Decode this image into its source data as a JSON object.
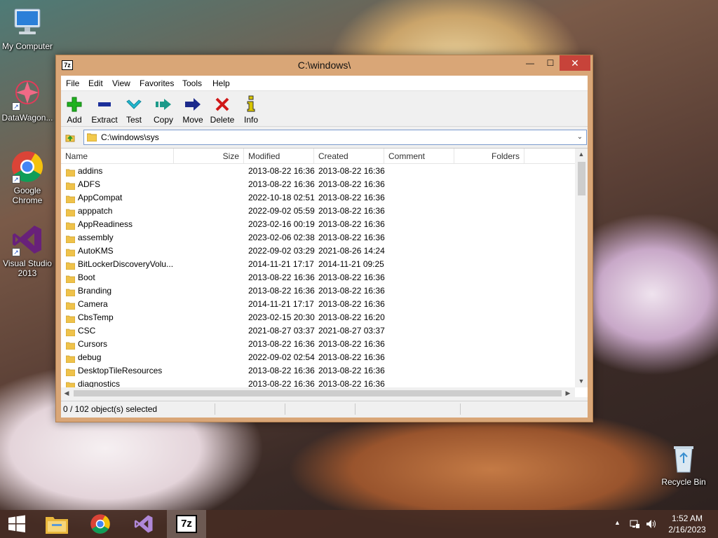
{
  "desktop": {
    "icons": [
      {
        "label": "My Computer"
      },
      {
        "label": "DataWagon..."
      },
      {
        "label": "Google Chrome"
      },
      {
        "label": "Visual Studio 2013"
      },
      {
        "label": "Recycle Bin"
      }
    ]
  },
  "window": {
    "app_icon_text": "7z",
    "title": "C:\\windows\\",
    "controls": {
      "minimize": "—",
      "maximize": "☐",
      "close": "✕"
    },
    "menu": [
      "File",
      "Edit",
      "View",
      "Favorites",
      "Tools",
      "Help"
    ],
    "toolbar": [
      {
        "label": "Add",
        "icon": "plus-icon",
        "color": "#1fb21f"
      },
      {
        "label": "Extract",
        "icon": "minus-icon",
        "color": "#1b2f9a"
      },
      {
        "label": "Test",
        "icon": "check-chevron-icon",
        "color": "#22b8d0"
      },
      {
        "label": "Copy",
        "icon": "double-arrow-icon",
        "color": "#1c9a8a"
      },
      {
        "label": "Move",
        "icon": "arrow-right-icon",
        "color": "#1d2b8c"
      },
      {
        "label": "Delete",
        "icon": "x-icon",
        "color": "#d01818"
      },
      {
        "label": "Info",
        "icon": "info-icon",
        "color": "#d8c400"
      }
    ],
    "address": {
      "value": "C:\\windows\\sys"
    },
    "columns": {
      "name": "Name",
      "size": "Size",
      "modified": "Modified",
      "created": "Created",
      "comment": "Comment",
      "folders": "Folders"
    },
    "files": [
      {
        "name": "addins",
        "modified": "2013-08-22 16:36",
        "created": "2013-08-22 16:36"
      },
      {
        "name": "ADFS",
        "modified": "2013-08-22 16:36",
        "created": "2013-08-22 16:36"
      },
      {
        "name": "AppCompat",
        "modified": "2022-10-18 02:51",
        "created": "2013-08-22 16:36"
      },
      {
        "name": "apppatch",
        "modified": "2022-09-02 05:59",
        "created": "2013-08-22 16:36"
      },
      {
        "name": "AppReadiness",
        "modified": "2023-02-16 00:19",
        "created": "2013-08-22 16:36"
      },
      {
        "name": "assembly",
        "modified": "2023-02-06 02:38",
        "created": "2013-08-22 16:36"
      },
      {
        "name": "AutoKMS",
        "modified": "2022-09-02 03:29",
        "created": "2021-08-26 14:24"
      },
      {
        "name": "BitLockerDiscoveryVolu...",
        "modified": "2014-11-21 17:17",
        "created": "2014-11-21 09:25"
      },
      {
        "name": "Boot",
        "modified": "2013-08-22 16:36",
        "created": "2013-08-22 16:36"
      },
      {
        "name": "Branding",
        "modified": "2013-08-22 16:36",
        "created": "2013-08-22 16:36"
      },
      {
        "name": "Camera",
        "modified": "2014-11-21 17:17",
        "created": "2013-08-22 16:36"
      },
      {
        "name": "CbsTemp",
        "modified": "2023-02-15 20:30",
        "created": "2013-08-22 16:20"
      },
      {
        "name": "CSC",
        "modified": "2021-08-27 03:37",
        "created": "2021-08-27 03:37"
      },
      {
        "name": "Cursors",
        "modified": "2013-08-22 16:36",
        "created": "2013-08-22 16:36"
      },
      {
        "name": "debug",
        "modified": "2022-09-02 02:54",
        "created": "2013-08-22 16:36"
      },
      {
        "name": "DesktopTileResources",
        "modified": "2013-08-22 16:36",
        "created": "2013-08-22 16:36"
      },
      {
        "name": "diagnostics",
        "modified": "2013-08-22 16:36",
        "created": "2013-08-22 16:36"
      }
    ],
    "status": {
      "selection": "0 / 102 object(s) selected"
    },
    "accent_color": "#d9a677"
  },
  "taskbar": {
    "items": [
      {
        "icon": "windows-start-icon"
      },
      {
        "icon": "file-explorer-icon"
      },
      {
        "icon": "chrome-icon"
      },
      {
        "icon": "visual-studio-icon"
      },
      {
        "icon": "7zip-icon",
        "active": true,
        "text": "7z"
      }
    ],
    "clock": {
      "time": "1:52 AM",
      "date": "2/16/2023"
    }
  }
}
